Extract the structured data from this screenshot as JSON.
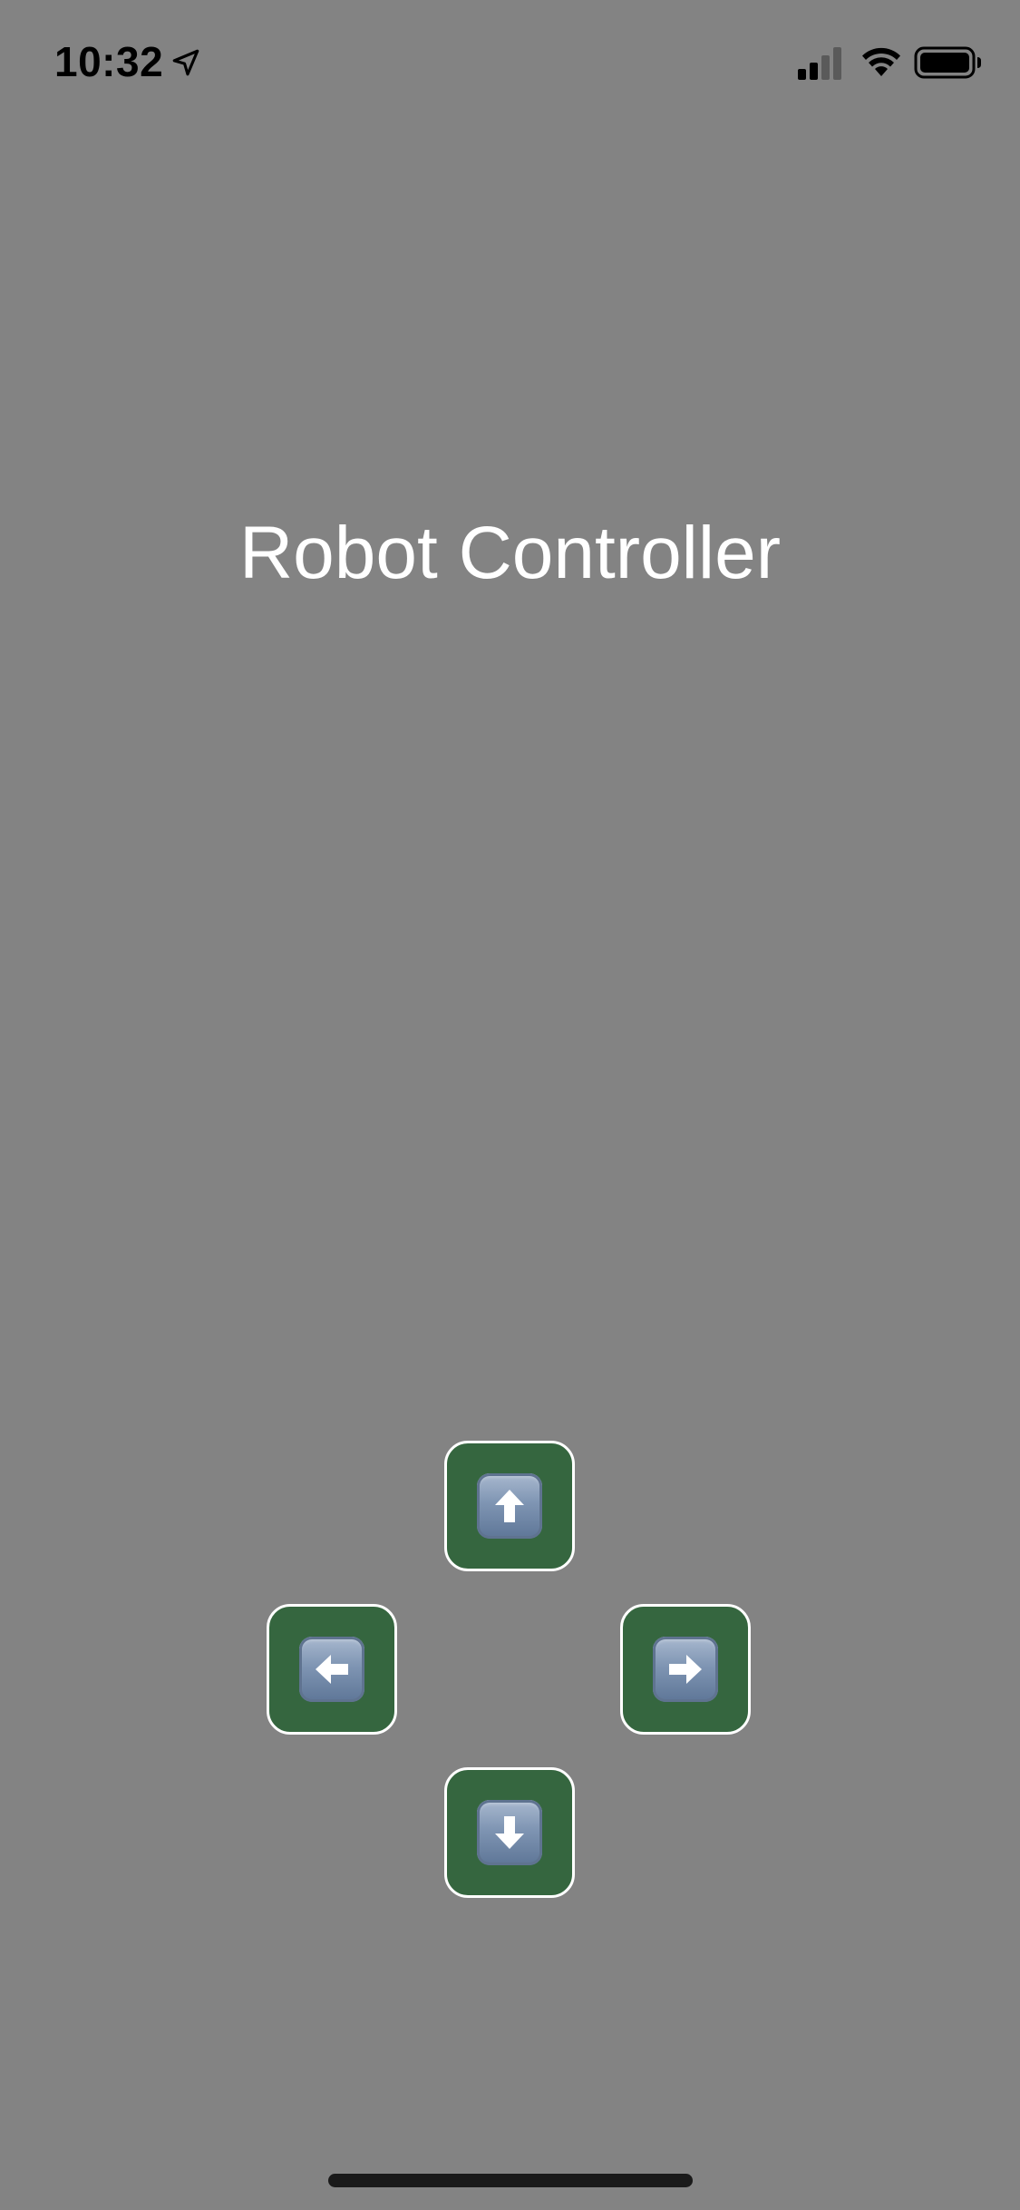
{
  "status_bar": {
    "time": "10:32",
    "location_icon": "location-arrow-icon",
    "signal_icon": "cellular-signal-icon",
    "wifi_icon": "wifi-icon",
    "battery_icon": "battery-icon"
  },
  "title": "Robot Controller",
  "controls": {
    "up": {
      "icon": "arrow-up-icon"
    },
    "left": {
      "icon": "arrow-left-icon"
    },
    "right": {
      "icon": "arrow-right-icon"
    },
    "down": {
      "icon": "arrow-down-icon"
    }
  },
  "colors": {
    "background": "#838383",
    "button_fill": "#35663f",
    "button_border": "#ffffff",
    "title_text": "#ffffff"
  }
}
